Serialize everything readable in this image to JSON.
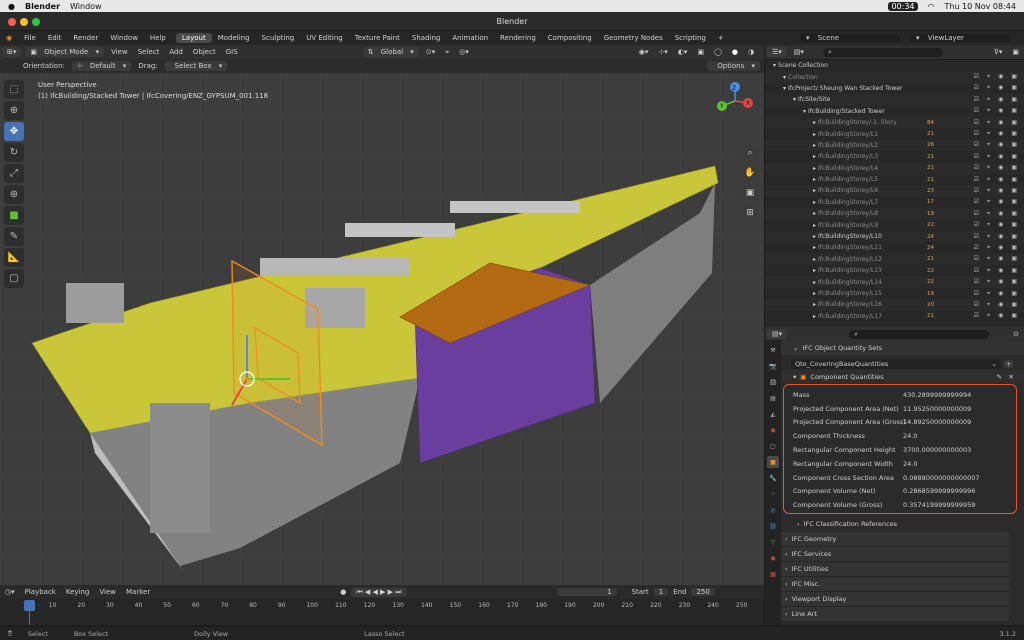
{
  "mac_menu": {
    "app": "Blender",
    "items": [
      "Window"
    ],
    "battery": "00:34",
    "date": "Thu 10 Nov  08:44"
  },
  "window_title": "Blender",
  "top_menu": {
    "items": [
      "File",
      "Edit",
      "Render",
      "Window",
      "Help"
    ],
    "workspaces": [
      "Layout",
      "Modeling",
      "Sculpting",
      "UV Editing",
      "Texture Paint",
      "Shading",
      "Animation",
      "Rendering",
      "Compositing",
      "Geometry Nodes",
      "Scripting"
    ],
    "active_workspace": "Layout",
    "add": "+"
  },
  "scene": {
    "name": "Scene",
    "view_layer": "ViewLayer"
  },
  "viewport_header": {
    "mode": "Object Mode",
    "menus": [
      "View",
      "Select",
      "Add",
      "Object",
      "GIS"
    ],
    "transform": "Global",
    "options": "Options"
  },
  "tool_settings": {
    "orientation_label": "Orientation:",
    "orientation_value": "Default",
    "drag_label": "Drag:",
    "drag_value": "Select Box"
  },
  "viewport": {
    "perspective": "User Perspective",
    "object_info": "(1) IfcBuilding/Stacked Tower | IfcCovering/ENZ_GYPSUM_001.118",
    "axis_x": "X",
    "axis_y": "Y",
    "axis_z": "Z"
  },
  "outliner": {
    "rows": [
      {
        "label": "Scene Collection",
        "indent": 0,
        "dim": false
      },
      {
        "label": "Collection",
        "indent": 1,
        "dim": true
      },
      {
        "label": "IfcProject/ Sheung Wan Stacked Tower",
        "indent": 1,
        "dim": false
      },
      {
        "label": "IfcSite/Site",
        "indent": 2,
        "dim": false
      },
      {
        "label": "IfcBuilding/Stacked Tower",
        "indent": 3,
        "dim": false
      },
      {
        "label": "IfcBuildingStorey/-1. Story",
        "indent": 4,
        "dim": true,
        "count": "84"
      },
      {
        "label": "IfcBuildingStorey/L1",
        "indent": 4,
        "dim": true,
        "count": "21"
      },
      {
        "label": "IfcBuildingStorey/L2",
        "indent": 4,
        "dim": true,
        "count": "26"
      },
      {
        "label": "IfcBuildingStorey/L3",
        "indent": 4,
        "dim": true,
        "count": "21"
      },
      {
        "label": "IfcBuildingStorey/L4",
        "indent": 4,
        "dim": true,
        "count": "21"
      },
      {
        "label": "IfcBuildingStorey/L5",
        "indent": 4,
        "dim": true,
        "count": "21"
      },
      {
        "label": "IfcBuildingStorey/L6",
        "indent": 4,
        "dim": true,
        "count": "23"
      },
      {
        "label": "IfcBuildingStorey/L7",
        "indent": 4,
        "dim": true,
        "count": "17"
      },
      {
        "label": "IfcBuildingStorey/L8",
        "indent": 4,
        "dim": true,
        "count": "19"
      },
      {
        "label": "IfcBuildingStorey/L9",
        "indent": 4,
        "dim": true,
        "count": "22"
      },
      {
        "label": "IfcBuildingStorey/L10",
        "indent": 4,
        "dim": false,
        "count": "24"
      },
      {
        "label": "IfcBuildingStorey/L11",
        "indent": 4,
        "dim": true,
        "count": "24"
      },
      {
        "label": "IfcBuildingStorey/L12",
        "indent": 4,
        "dim": true,
        "count": "21"
      },
      {
        "label": "IfcBuildingStorey/L13",
        "indent": 4,
        "dim": true,
        "count": "22"
      },
      {
        "label": "IfcBuildingStorey/L14",
        "indent": 4,
        "dim": true,
        "count": "22"
      },
      {
        "label": "IfcBuildingStorey/L15",
        "indent": 4,
        "dim": true,
        "count": "19"
      },
      {
        "label": "IfcBuildingStorey/L16",
        "indent": 4,
        "dim": true,
        "count": "20"
      },
      {
        "label": "IfcBuildingStorey/L17",
        "indent": 4,
        "dim": true,
        "count": "21"
      }
    ]
  },
  "properties": {
    "panel_title": "IFC Object Quantity Sets",
    "qset": "Qto_CoveringBaseQuantities",
    "subpanel": "Component Quantities",
    "quantities": [
      {
        "name": "Mass",
        "value": "430.2899999999994"
      },
      {
        "name": "Projected Component Area (Net)",
        "value": "11.95250000000009"
      },
      {
        "name": "Projected Component Area (Gross)",
        "value": "14.89250000000009"
      },
      {
        "name": "Component Thickness",
        "value": "24.0"
      },
      {
        "name": "Rectangular Component Height",
        "value": "3700.000000000003"
      },
      {
        "name": "Rectangular Component Width",
        "value": "24.0"
      },
      {
        "name": "Component Cross Section Area",
        "value": "0.08880000000000007"
      },
      {
        "name": "Component Volume (Net)",
        "value": "0.2868599999999996"
      },
      {
        "name": "Component Volume (Gross)",
        "value": "0.3574199999999959"
      }
    ],
    "classification": "IFC Classification References",
    "sections": [
      "IFC Geometry",
      "IFC Services",
      "IFC Utilities",
      "IFC Misc.",
      "Viewport Display",
      "Line Art"
    ],
    "highlight_color": "#e4572e"
  },
  "timeline": {
    "menus": [
      "Playback",
      "Keying",
      "View",
      "Marker"
    ],
    "current_frame": "1",
    "start_label": "Start",
    "start": "1",
    "end_label": "End",
    "end": "250",
    "ticks": [
      "1",
      "10",
      "20",
      "30",
      "40",
      "50",
      "60",
      "70",
      "80",
      "90",
      "100",
      "110",
      "120",
      "130",
      "140",
      "150",
      "160",
      "170",
      "180",
      "190",
      "200",
      "210",
      "220",
      "230",
      "240",
      "250"
    ]
  },
  "status_bar": {
    "items": [
      "Select",
      "Box Select",
      "Dolly View",
      "Lasso Select"
    ],
    "version": "3.1.2"
  },
  "colors": {
    "accent": "#4772b3",
    "floor": "#c9c63a",
    "purple": "#6a3e9e",
    "orange": "#f08a24"
  }
}
